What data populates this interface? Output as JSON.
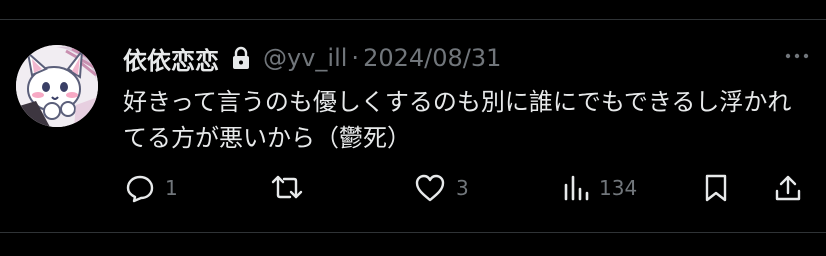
{
  "tweet": {
    "display_name": "依依恋恋",
    "handle": "@yv_ill",
    "separator": "·",
    "date": "2024/08/31",
    "text": "好きって言うのも優しくするのも別に誰にでもできるし浮かれてる方が悪いから（鬱死）"
  },
  "actions": {
    "replies": "1",
    "retweets": "",
    "likes": "3",
    "views": "134"
  },
  "icons": {
    "lock": "lock-icon",
    "more": "more-icon",
    "reply": "reply-icon",
    "retweet": "retweet-icon",
    "like": "heart-icon",
    "views": "views-icon",
    "bookmark": "bookmark-icon",
    "share": "share-icon"
  },
  "colors": {
    "background": "#000000",
    "text": "#e7e9ea",
    "muted": "#71767b",
    "divider": "#2f3336"
  }
}
